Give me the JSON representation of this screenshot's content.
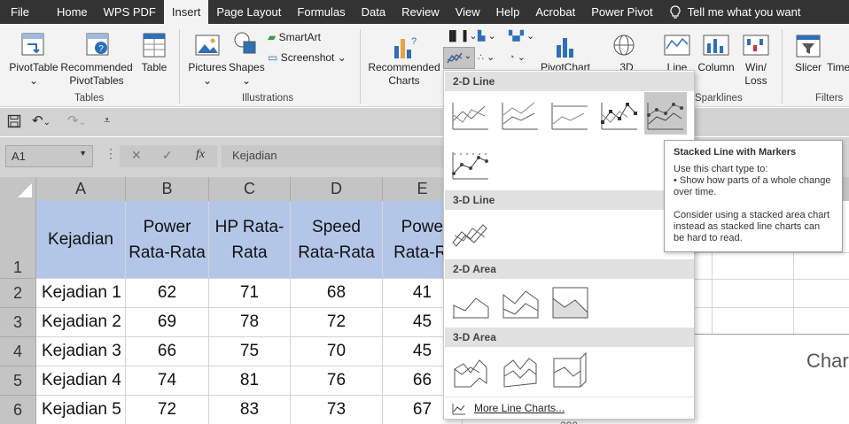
{
  "menu": {
    "items": [
      "File",
      "Home",
      "WPS PDF",
      "Insert",
      "Page Layout",
      "Formulas",
      "Data",
      "Review",
      "View",
      "Help",
      "Acrobat",
      "Power Pivot"
    ],
    "active": "Insert",
    "tell_me": "Tell me what you want"
  },
  "ribbon": {
    "pivottable": "PivotTable",
    "recommended_pivottables_1": "Recommended",
    "recommended_pivottables_2": "PivotTables",
    "table": "Table",
    "tables_group": "Tables",
    "pictures": "Pictures",
    "shapes": "Shapes",
    "smartart": "SmartArt",
    "screenshot": "Screenshot",
    "illustrations_group": "Illustrations",
    "recommended_charts_1": "Recommended",
    "recommended_charts_2": "Charts",
    "pivotchart": "PivotChart",
    "map3d": "3D",
    "line": "Line",
    "column": "Column",
    "winloss_1": "Win/",
    "winloss_2": "Loss",
    "sparklines_group": "Sparklines",
    "slicer": "Slicer",
    "timeline": "Time",
    "filters_group": "Filters"
  },
  "formula_bar": {
    "name_box": "A1",
    "fx": "fx",
    "value": "Kejadian"
  },
  "columns": [
    "A",
    "B",
    "C",
    "D",
    "E"
  ],
  "rows": [
    "1",
    "2",
    "3",
    "4",
    "5",
    "6"
  ],
  "table": {
    "headers": [
      "Kejadian",
      "Power Rata-Rata",
      "HP Rata-Rata",
      "Speed Rata-Rata",
      "Power Rata-Ra"
    ],
    "data": [
      [
        "Kejadian 1",
        "62",
        "71",
        "68",
        "41"
      ],
      [
        "Kejadian 2",
        "69",
        "78",
        "72",
        "45"
      ],
      [
        "Kejadian 3",
        "66",
        "75",
        "70",
        "45"
      ],
      [
        "Kejadian 4",
        "74",
        "81",
        "76",
        "66"
      ],
      [
        "Kejadian 5",
        "72",
        "83",
        "73",
        "67"
      ]
    ]
  },
  "dropdown": {
    "section_2d_line": "2-D Line",
    "section_3d_line": "3-D Line",
    "section_2d_area": "2-D Area",
    "section_3d_area": "3-D Area",
    "more": "More Line Charts..."
  },
  "tooltip": {
    "title": "Stacked Line with Markers",
    "line1": "Use this chart type to:",
    "line2": "• Show how parts of a whole change over time.",
    "line3": "Consider using a stacked area chart instead as stacked line charts can be hard to read."
  },
  "chart_fragment": "Char",
  "axis_fragment": "200"
}
